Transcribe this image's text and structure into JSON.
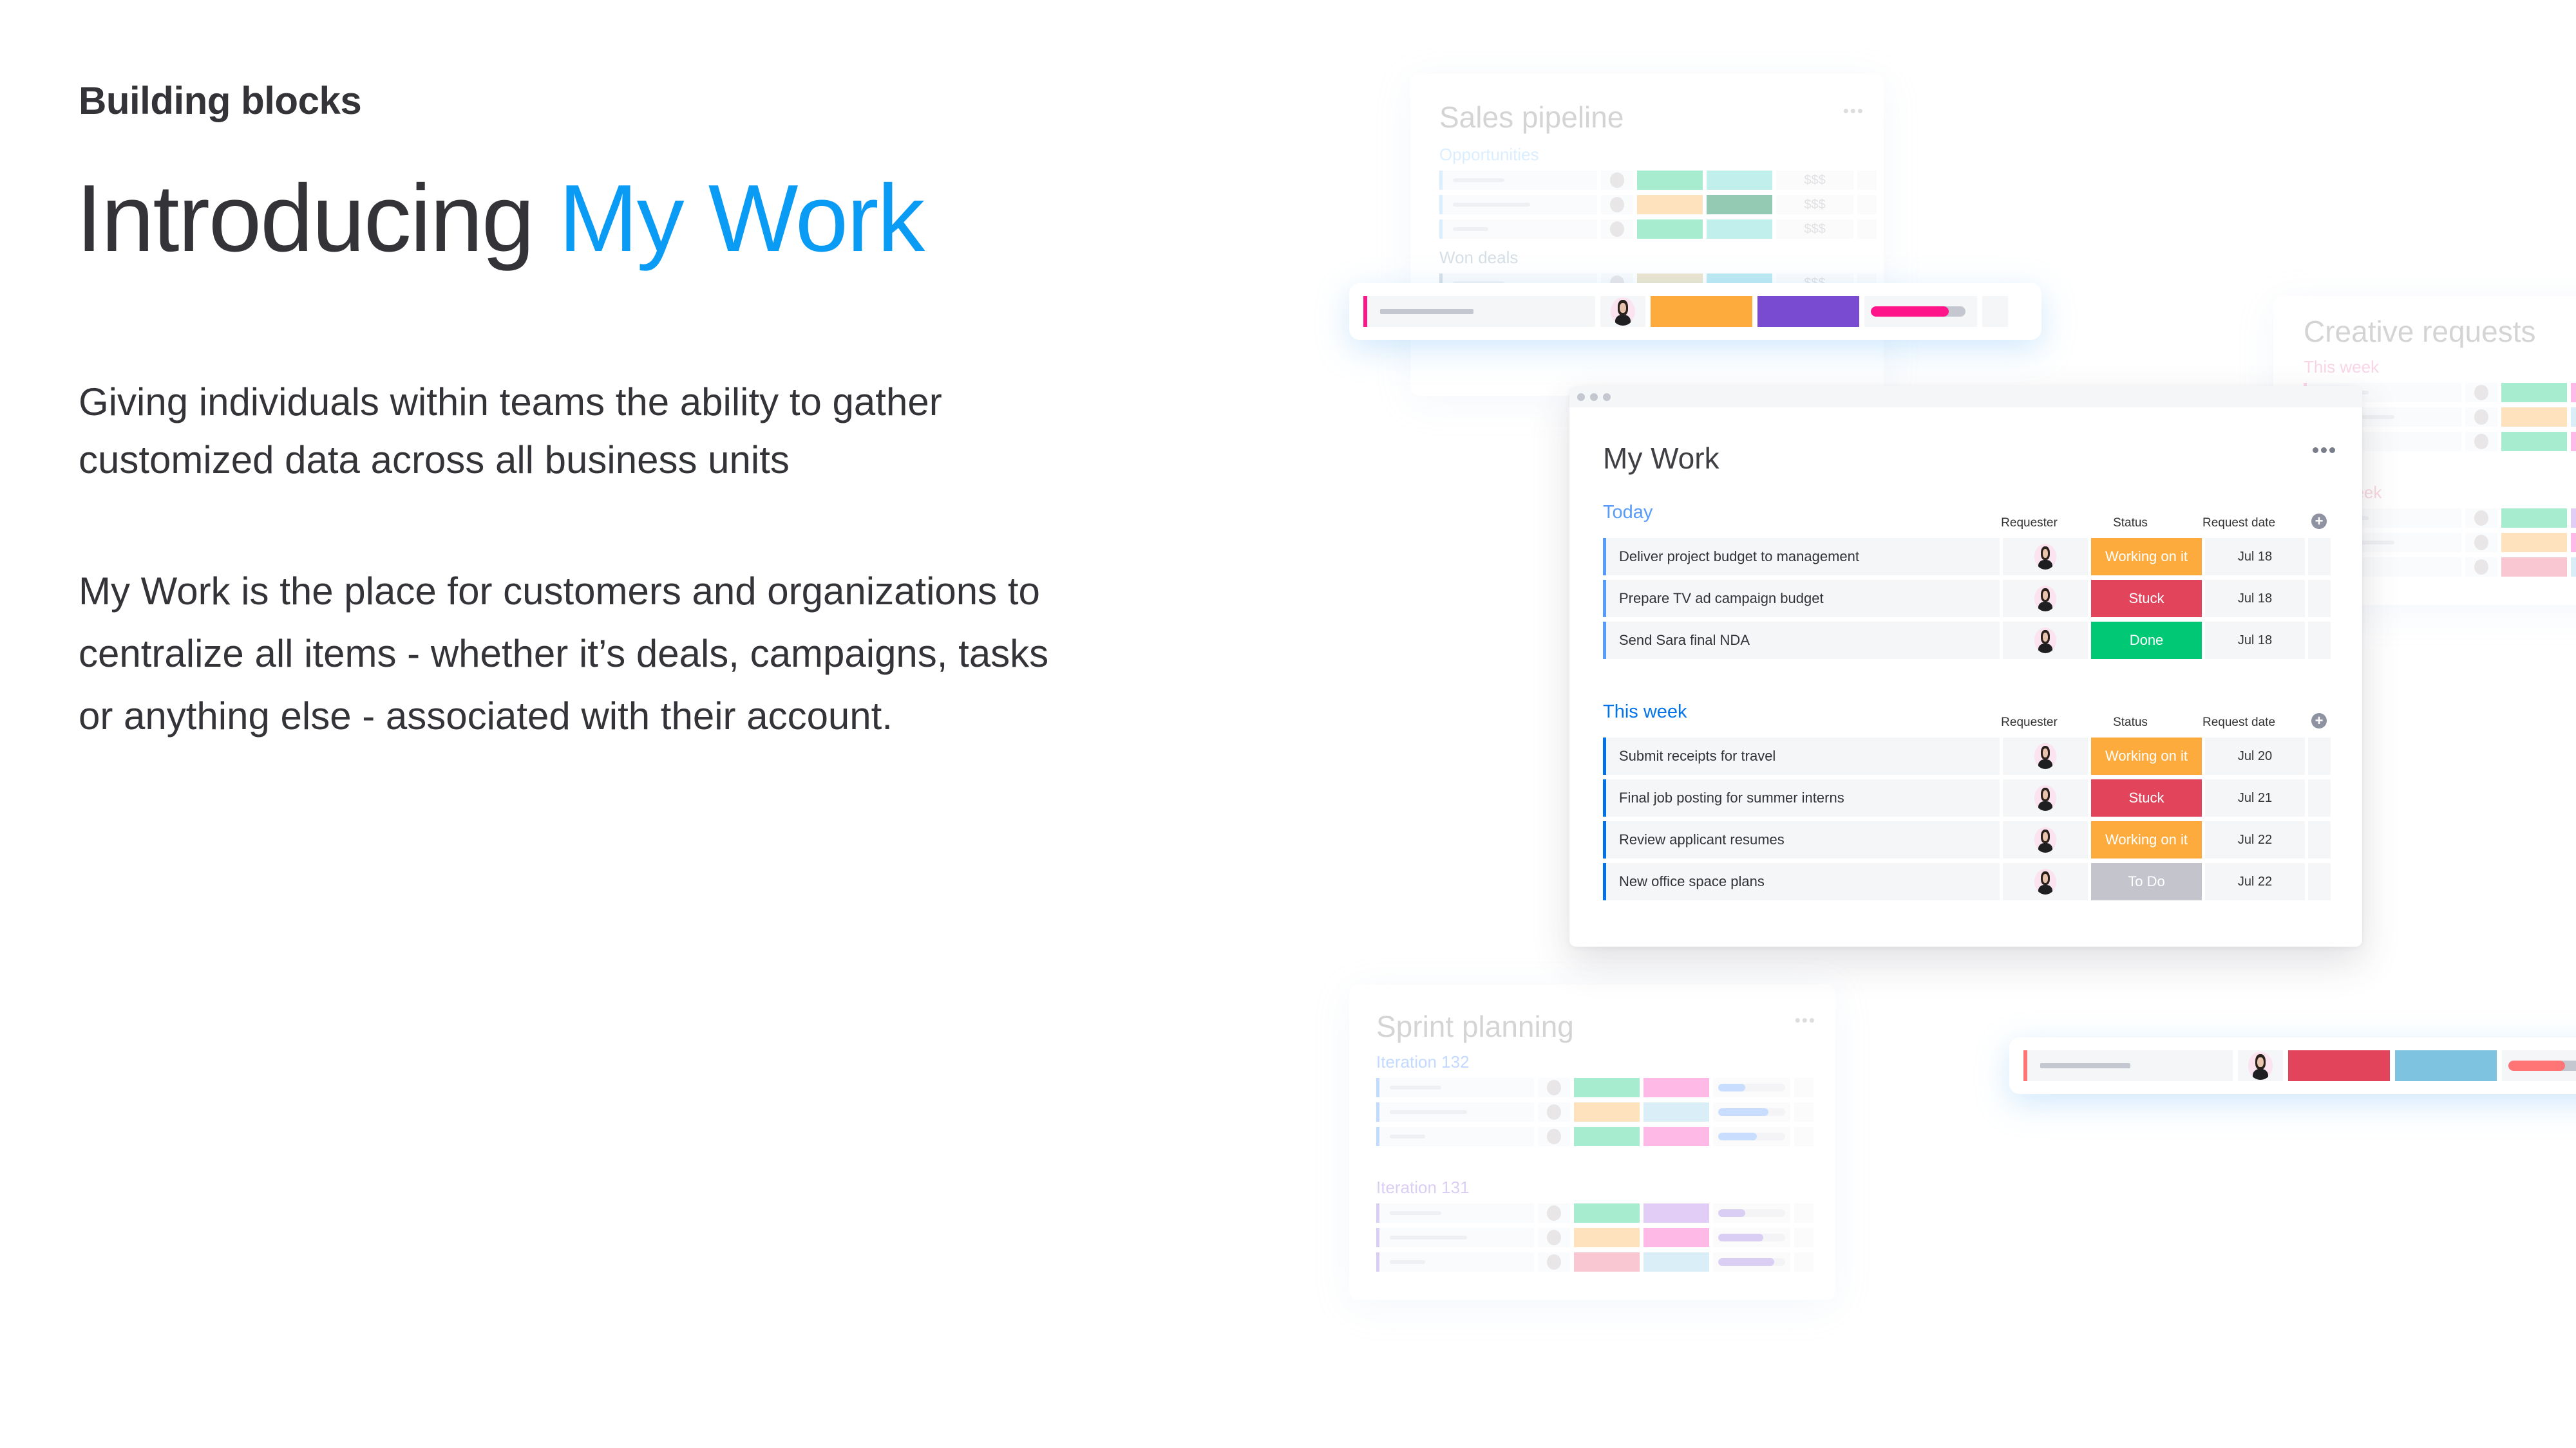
{
  "slide": {
    "eyebrow": "Building blocks",
    "headline_part1": "Introducing ",
    "headline_accent": "My Work",
    "paragraph1": "Giving individuals within teams the ability to gather customized data across all business units",
    "paragraph2": "My Work is the place for customers and organizations to centralize all items - whether it’s deals, campaigns, tasks or anything else - associated with their account."
  },
  "colors": {
    "accent": "#0A9CF5",
    "working_on_it": "#FDAB3D",
    "stuck": "#E2445C",
    "done": "#00C875",
    "todo": "#C4C4CC",
    "group_today": "#579BFC",
    "group_this_week": "#0073EA"
  },
  "my_work": {
    "title": "My Work",
    "menu_icon": "more-dots-icon",
    "columns": {
      "requester": "Requester",
      "status": "Status",
      "request_date": "Request date"
    },
    "groups": [
      {
        "name": "Today",
        "color": "#579BFC",
        "items": [
          {
            "name": "Deliver project budget to management",
            "status": "Working on it",
            "status_color": "#FDAB3D",
            "date": "Jul 18"
          },
          {
            "name": "Prepare TV ad campaign budget",
            "status": "Stuck",
            "status_color": "#E2445C",
            "date": "Jul 18"
          },
          {
            "name": "Send Sara final NDA",
            "status": "Done",
            "status_color": "#00C875",
            "date": "Jul 18"
          }
        ]
      },
      {
        "name": "This week",
        "color": "#0073EA",
        "items": [
          {
            "name": "Submit receipts for travel",
            "status": "Working on it",
            "status_color": "#FDAB3D",
            "date": "Jul 20"
          },
          {
            "name": "Final job posting for summer interns",
            "status": "Stuck",
            "status_color": "#E2445C",
            "date": "Jul 21"
          },
          {
            "name": "Review applicant resumes",
            "status": "Working on it",
            "status_color": "#FDAB3D",
            "date": "Jul 22"
          },
          {
            "name": "New office space plans",
            "status": "To Do",
            "status_color": "#C4C4CC",
            "date": "Jul 22"
          }
        ]
      }
    ]
  },
  "background_boards": {
    "sales_pipeline": {
      "title": "Sales pipeline",
      "groups": [
        {
          "name": "Opportunities",
          "color": "#A8D8FF",
          "money": "$$$",
          "rows": [
            {
              "chip_a": "#33D391",
              "chip_b": "#6EDBD1"
            },
            {
              "chip_a": "#FDBC64",
              "chip_b": "#037F4C"
            },
            {
              "chip_a": "#33D391",
              "chip_b": "#6EDBD1"
            }
          ]
        },
        {
          "name": "Won deals",
          "color": "#A0B5C5",
          "money": "$$$",
          "rows": [
            {
              "chip_a": "#D5C28A",
              "chip_b": "#66CCE0"
            },
            {
              "chip_a": "#E2A0B8",
              "chip_b": "#3AA686"
            }
          ]
        }
      ]
    },
    "creative_requests": {
      "title": "Creative requests",
      "groups": [
        {
          "name": "This week",
          "color": "#F59CC8",
          "rows": [
            {
              "chip_a": "#33D391",
              "chip_b": "#FF5AC4"
            },
            {
              "chip_a": "#FDBC64",
              "chip_b": "#A8D8F0"
            },
            {
              "chip_a": "#33D391",
              "chip_b": "#FF5AC4"
            }
          ]
        },
        {
          "name": "Next week",
          "color": "#F2A0B0",
          "rows": [
            {
              "chip_a": "#33D391",
              "chip_b": "#B98AE8"
            },
            {
              "chip_a": "#FDBC64",
              "chip_b": "#FF5AC4"
            },
            {
              "chip_a": "#F07C94",
              "chip_b": "#A8D8F0"
            }
          ]
        }
      ]
    },
    "sprint_planning": {
      "title": "Sprint planning",
      "groups": [
        {
          "name": "Iteration 132",
          "color": "#6FA8FF",
          "progress_color": "#7FB3FF",
          "rows": [
            {
              "chip_a": "#33D391",
              "chip_b": "#FF5AC4",
              "progress": 0.4
            },
            {
              "chip_a": "#FDBC64",
              "chip_b": "#A8D8F0",
              "progress": 0.75
            },
            {
              "chip_a": "#33D391",
              "chip_b": "#FF5AC4",
              "progress": 0.58
            }
          ]
        },
        {
          "name": "Iteration 131",
          "color": "#A98BE8",
          "progress_color": "#A98BE8",
          "rows": [
            {
              "chip_a": "#33D391",
              "chip_b": "#B98AE8",
              "progress": 0.4
            },
            {
              "chip_a": "#FDBC64",
              "chip_b": "#FF5AC4",
              "progress": 0.67
            },
            {
              "chip_a": "#F07C94",
              "chip_b": "#A8D8F0",
              "progress": 0.84
            }
          ]
        }
      ]
    }
  },
  "floating_rows": [
    {
      "edge_color": "#FF158A",
      "chip_a": "#FDAB3D",
      "chip_b": "#784BD1",
      "progress_color": "#FF158A",
      "progress": 0.82
    },
    {
      "edge_color": "#FF7575",
      "chip_a": "#E2445C",
      "chip_b": "#7EC3E0",
      "progress_color": "#FF7575",
      "progress": 0.6
    }
  ]
}
